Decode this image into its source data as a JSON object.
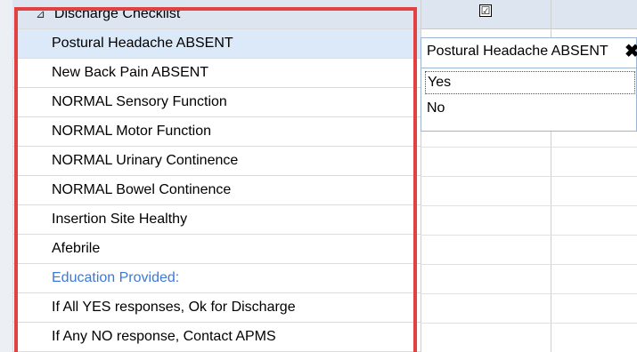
{
  "checklist": {
    "header": "Discharge Checklist",
    "rows": [
      "Postural Headache ABSENT",
      "New Back Pain ABSENT",
      "NORMAL Sensory Function",
      "NORMAL Motor Function",
      "NORMAL Urinary Continence",
      "NORMAL Bowel Continence",
      "Insertion Site Healthy",
      "Afebrile",
      "Education Provided:",
      "If All YES responses, Ok for Discharge",
      "If Any NO response, Contact APMS"
    ]
  },
  "column": {
    "checkbox_glyph": "☑"
  },
  "dropdown": {
    "title": "Postural Headache ABSENT",
    "close_glyph": "✖",
    "options": [
      "Yes",
      "No"
    ]
  },
  "colors": {
    "header_bg": "#dde5f0",
    "selected_bg": "#dbe9f9",
    "highlight_frame": "#e14141",
    "section_text": "#3b78d8"
  }
}
